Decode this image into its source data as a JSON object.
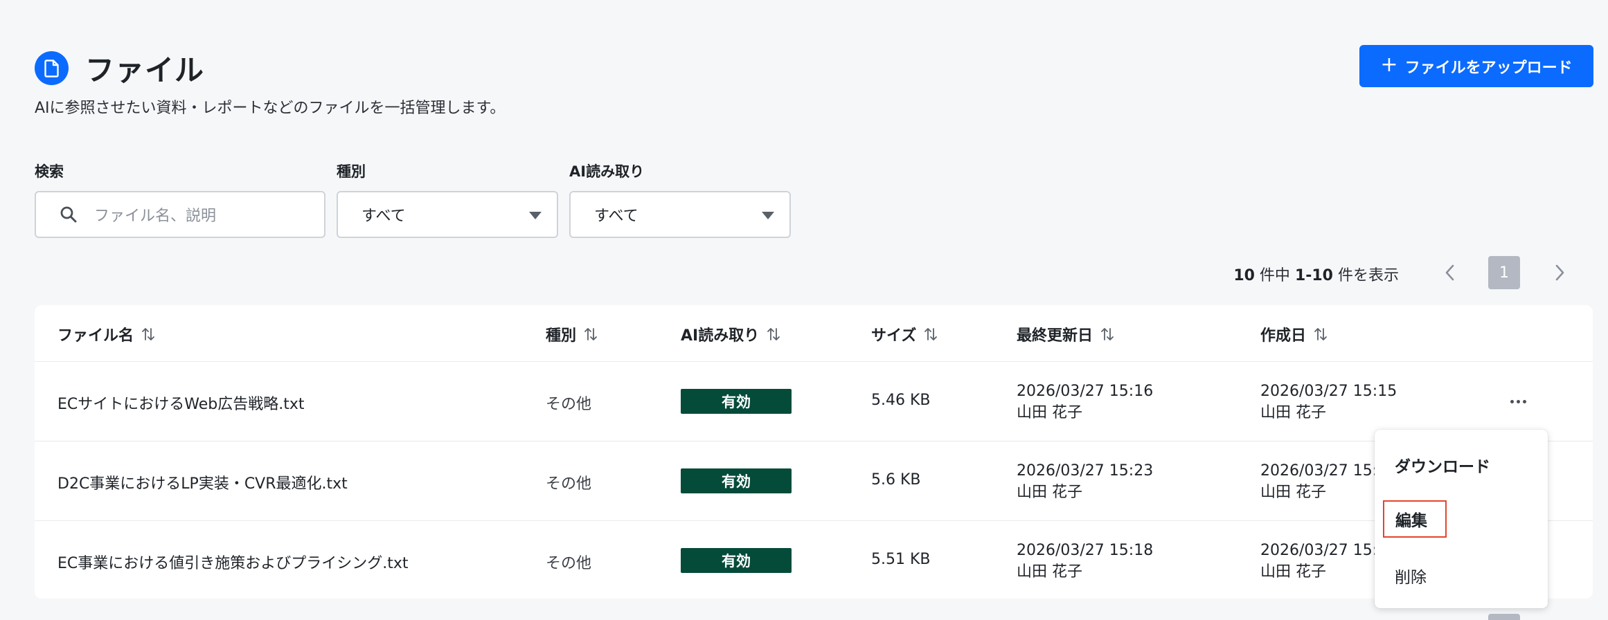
{
  "header": {
    "title": "ファイル",
    "description": "AIに参照させたい資料・レポートなどのファイルを一括管理します。",
    "upload_label": "ファイルをアップロード",
    "upload_plus": "+"
  },
  "filters": {
    "search_label": "検索",
    "search_placeholder": "ファイル名、説明",
    "type_label": "種別",
    "type_value": "すべて",
    "ai_label": "AI読み取り",
    "ai_value": "すべて"
  },
  "pagination": {
    "total": "10",
    "total_suffix": " 件中 ",
    "range": "1-10",
    "range_suffix": " 件を表示",
    "current_page": "1"
  },
  "table": {
    "columns": {
      "name": "ファイル名",
      "type": "種別",
      "ai": "AI読み取り",
      "size": "サイズ",
      "updated": "最終更新日",
      "created": "作成日"
    },
    "rows": [
      {
        "name": "ECサイトにおけるWeb広告戦略.txt",
        "type": "その他",
        "ai": "有効",
        "size": "5.46 KB",
        "updated_date": "2026/03/27 15:16",
        "updated_by": "山田 花子",
        "created_date": "2026/03/27 15:15",
        "created_by": "山田 花子"
      },
      {
        "name": "D2C事業におけるLP実装・CVR最適化.txt",
        "type": "その他",
        "ai": "有効",
        "size": "5.6 KB",
        "updated_date": "2026/03/27 15:23",
        "updated_by": "山田 花子",
        "created_date": "2026/03/27 15:",
        "created_by": "山田 花子"
      },
      {
        "name": "EC事業における値引き施策およびプライシング.txt",
        "type": "その他",
        "ai": "有効",
        "size": "5.51 KB",
        "updated_date": "2026/03/27 15:18",
        "updated_by": "山田 花子",
        "created_date": "2026/03/27 15:",
        "created_by": "山田 花子"
      }
    ]
  },
  "menu": {
    "download": "ダウンロード",
    "edit": "編集",
    "delete": "削除"
  },
  "colors": {
    "primary": "#0b6bff",
    "badge": "#054b3a",
    "highlight": "#e4442d",
    "page_bg": "#f6f7f9"
  }
}
